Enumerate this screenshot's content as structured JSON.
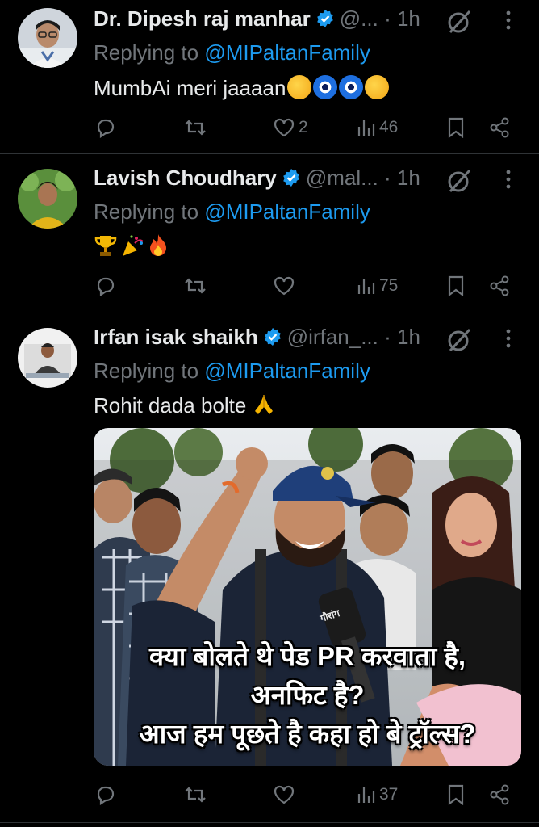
{
  "tweets": [
    {
      "name": "Dr. Dipesh raj manhar",
      "handle": "@...",
      "time": "· 1h",
      "replying_prefix": "Replying to",
      "replying_to": "@MIPaltanFamily",
      "text": "MumbAi meri jaaaan",
      "emojis": [
        "partying-face-emoji",
        "nazar-amulet-emoji",
        "nazar-amulet-emoji",
        "partying-face-emoji"
      ],
      "likes": "2",
      "views": "46"
    },
    {
      "name": "Lavish Choudhary",
      "handle": "@mal...",
      "time": "· 1h",
      "replying_prefix": "Replying to",
      "replying_to": "@MIPaltanFamily",
      "text": "",
      "emojis": [
        "trophy-emoji",
        "party-popper-emoji",
        "fire-emoji"
      ],
      "likes": "",
      "views": "75"
    },
    {
      "name": "Irfan isak shaikh",
      "handle": "@irfan_...",
      "time": "· 1h",
      "replying_prefix": "Replying to",
      "replying_to": "@MIPaltanFamily",
      "text": "Rohit dada bolte",
      "emojis": [
        "folded-hands-emoji"
      ],
      "likes": "",
      "views": "37",
      "media": {
        "mic_label": "गौरांग",
        "caption_lines": [
          "क्या बोलते थे पेड PR करवाता है,",
          "अनफिट है?",
          "आज हम पूछते है कहा हो बे ट्रॉल्स?"
        ]
      }
    }
  ],
  "colors": {
    "background": "#000000",
    "text_primary": "#e7e9ea",
    "text_secondary": "#71767b",
    "accent": "#1d9bf0",
    "separator": "#2f3336"
  },
  "icons": [
    "reply-icon",
    "retweet-icon",
    "like-icon",
    "views-icon",
    "bookmark-icon",
    "share-icon",
    "verified-badge-icon",
    "grok-icon",
    "more-icon"
  ]
}
